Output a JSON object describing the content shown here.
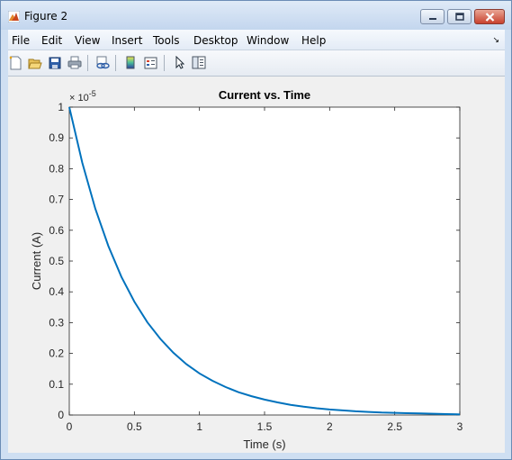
{
  "window": {
    "title": "Figure 2",
    "icons": {
      "app": "matlab-logo-icon",
      "minimize": "minimize-icon",
      "maximize": "maximize-icon",
      "close": "close-icon"
    }
  },
  "menubar": {
    "items": [
      "File",
      "Edit",
      "View",
      "Insert",
      "Tools",
      "Desktop",
      "Window",
      "Help"
    ],
    "overflow_icon": "dock-arrow-icon"
  },
  "toolbar": {
    "tools": [
      "new-figure-icon",
      "open-file-icon",
      "save-icon",
      "print-icon",
      "link-plot-icon",
      "colorbar-icon",
      "legend-icon",
      "pointer-icon",
      "property-editor-icon"
    ]
  },
  "chart_data": {
    "type": "line",
    "title": "Current vs. Time",
    "xlabel": "Time (s)",
    "ylabel": "Current (A)",
    "y_exponent_label": "× 10^-5",
    "y_exponent_base": "× 10",
    "y_exponent_power": "-5",
    "xlim": [
      0,
      3
    ],
    "ylim": [
      0,
      1
    ],
    "xticks": [
      "0",
      "0.5",
      "1",
      "1.5",
      "2",
      "2.5",
      "3"
    ],
    "yticks": [
      "0",
      "0.1",
      "0.2",
      "0.3",
      "0.4",
      "0.5",
      "0.6",
      "0.7",
      "0.8",
      "0.9",
      "1"
    ],
    "grid": false,
    "line_color": "#0072bd",
    "series": [
      {
        "x": [
          0,
          0.1,
          0.2,
          0.3,
          0.4,
          0.5,
          0.6,
          0.7,
          0.8,
          0.9,
          1.0,
          1.1,
          1.2,
          1.3,
          1.4,
          1.5,
          1.6,
          1.7,
          1.8,
          1.9,
          2.0,
          2.1,
          2.2,
          2.3,
          2.4,
          2.5,
          2.6,
          2.7,
          2.8,
          2.9,
          3.0
        ],
        "y": [
          1.0,
          0.819,
          0.67,
          0.549,
          0.449,
          0.368,
          0.301,
          0.247,
          0.202,
          0.165,
          0.135,
          0.111,
          0.091,
          0.074,
          0.061,
          0.05,
          0.041,
          0.033,
          0.027,
          0.022,
          0.018,
          0.015,
          0.012,
          0.01,
          0.008,
          0.007,
          0.006,
          0.005,
          0.004,
          0.003,
          0.002
        ]
      }
    ]
  }
}
